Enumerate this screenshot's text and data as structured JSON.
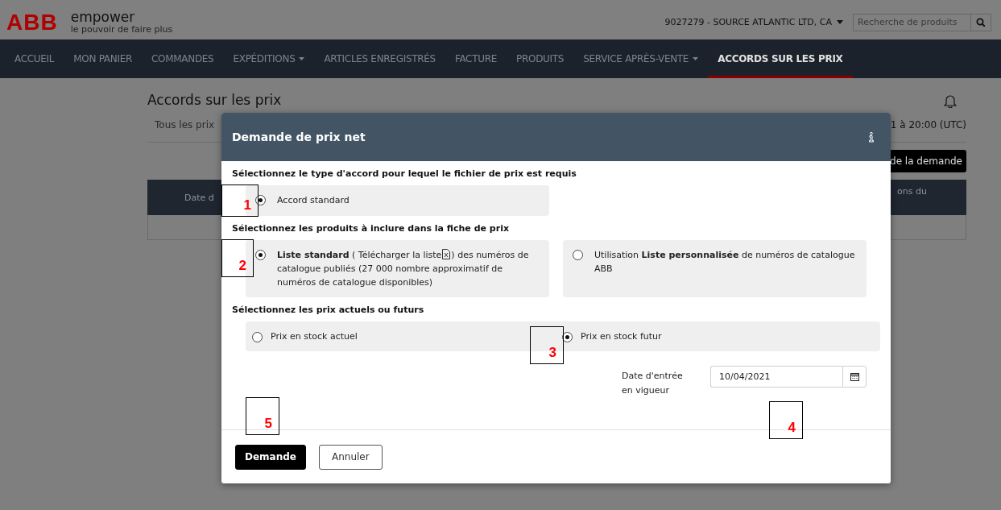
{
  "header": {
    "logo": "ABB",
    "brand": "empower",
    "tagline": "le pouvoir de faire plus",
    "account": "9027279 - SOURCE ATLANTIC LTD, CA",
    "search": {
      "placeholder": "Recherche de produits"
    }
  },
  "nav": [
    {
      "label": "ACCUEIL",
      "selected": false,
      "dropdown": false
    },
    {
      "label": "MON PANIER",
      "selected": false,
      "dropdown": false
    },
    {
      "label": "COMMANDES",
      "selected": false,
      "dropdown": false
    },
    {
      "label": "EXPÉDITIONS",
      "selected": false,
      "dropdown": true
    },
    {
      "label": "ARTICLES ENREGISTRÉS",
      "selected": false,
      "dropdown": false
    },
    {
      "label": "FACTURE",
      "selected": false,
      "dropdown": false
    },
    {
      "label": "PRODUITS",
      "selected": false,
      "dropdown": false
    },
    {
      "label": "SERVICE APRÈS-VENTE",
      "selected": false,
      "dropdown": true
    },
    {
      "label": "ACCORDS SUR LES PRIX",
      "selected": true,
      "dropdown": false
    }
  ],
  "background": {
    "title": "Accords sur les prix",
    "tab": "Tous les prix",
    "date_fragment": "1 à 20:00 (UTC)",
    "button_fragment": "de la demande",
    "column_1_fragment": "Date d",
    "column_2_fragment": "ons du"
  },
  "dialog": {
    "title": "Demande de prix net",
    "sections": [
      {
        "label": "Sélectionnez le type d'accord pour lequel le fichier de prix est requis",
        "kind": "cards",
        "options": [
          {
            "selected": true,
            "parts": [
              {
                "kind": "text",
                "text": "Accord standard"
              }
            ]
          }
        ]
      },
      {
        "label": "Sélectionnez les produits à inclure dans la fiche de prix",
        "kind": "cards",
        "options": [
          {
            "selected": true,
            "parts": [
              {
                "kind": "text",
                "text": "**Liste standard** ( "
              },
              {
                "kind": "link",
                "text": "Télécharger la liste"
              },
              {
                "kind": "text",
                "text": ") des numéros de catalogue publiés (27 000 nombre approximatif de numéros de catalogue disponibles)"
              }
            ]
          },
          {
            "selected": false,
            "parts": [
              {
                "kind": "text",
                "text": "Utilisation **Liste personnalisée** de numéros de catalogue ABB"
              }
            ]
          }
        ]
      },
      {
        "label": "Sélectionnez les prix actuels ou futurs",
        "kind": "strip",
        "options": [
          {
            "selected": false,
            "parts": [
              {
                "kind": "text",
                "text": "Prix en stock actuel"
              }
            ]
          },
          {
            "selected": true,
            "parts": [
              {
                "kind": "text",
                "text": "Prix en stock futur"
              }
            ]
          }
        ]
      }
    ],
    "date": {
      "label": "Date d'entrée en vigueur",
      "value": "10/04/2021"
    },
    "buttons": [
      {
        "label": "Demande",
        "kind": "primary"
      },
      {
        "label": "Annuler",
        "kind": "secondary"
      }
    ]
  },
  "annotations": [
    {
      "number": "1"
    },
    {
      "number": "2"
    },
    {
      "number": "3"
    },
    {
      "number": "4"
    },
    {
      "number": "5"
    }
  ]
}
